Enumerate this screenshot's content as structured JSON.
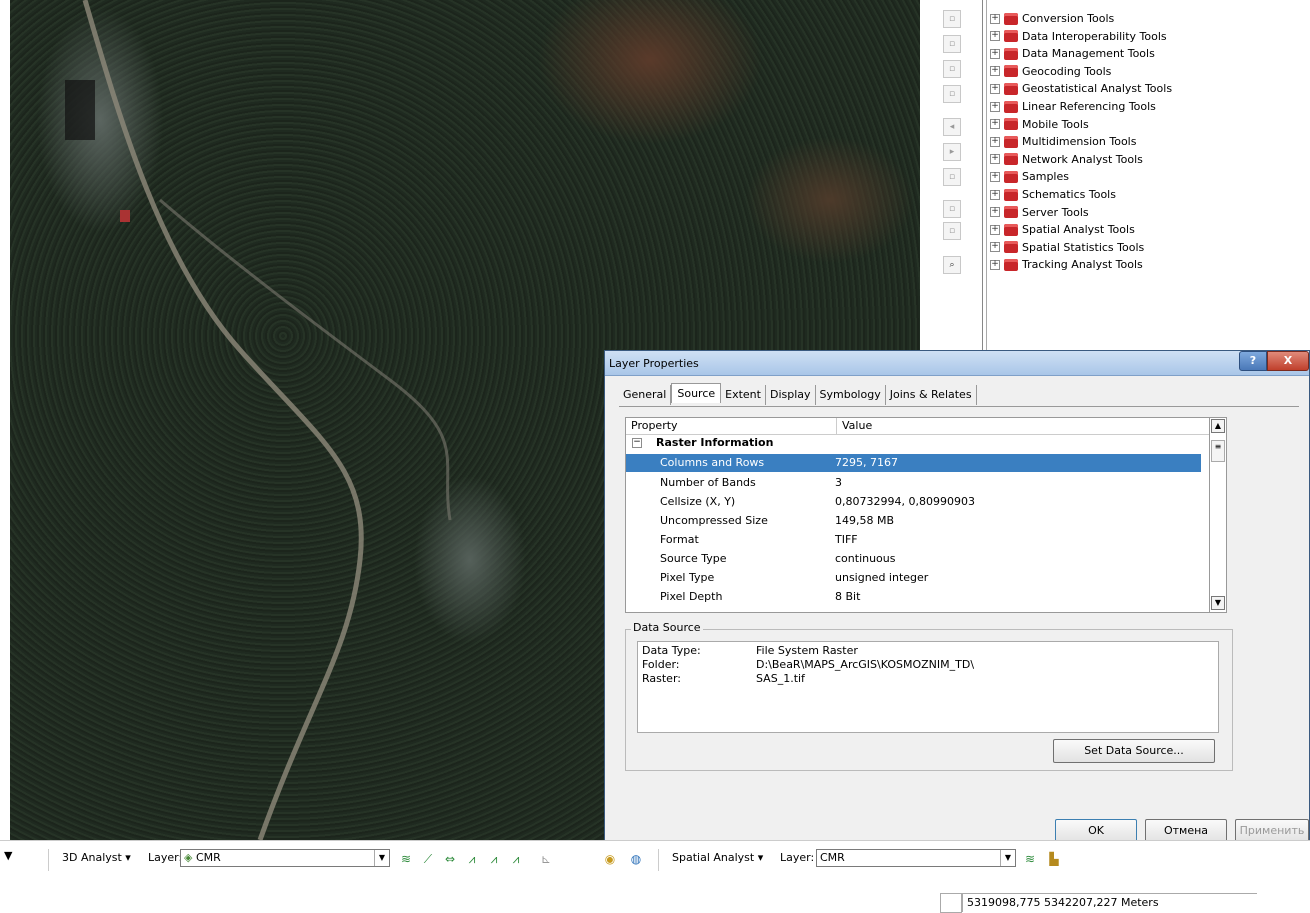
{
  "toolbox": {
    "items": [
      "Conversion Tools",
      "Data Interoperability Tools",
      "Data Management Tools",
      "Geocoding Tools",
      "Geostatistical Analyst Tools",
      "Linear Referencing Tools",
      "Mobile Tools",
      "Multidimension Tools",
      "Network Analyst Tools",
      "Samples",
      "Schematics Tools",
      "Server Tools",
      "Spatial Analyst Tools",
      "Spatial Statistics Tools",
      "Tracking Analyst Tools"
    ]
  },
  "dialog": {
    "title": "Layer Properties",
    "help": "?",
    "close": "X",
    "tabs": [
      "General",
      "Source",
      "Extent",
      "Display",
      "Symbology",
      "Joins & Relates"
    ],
    "active_tab": "Source",
    "grid": {
      "col_property": "Property",
      "col_value": "Value",
      "group": "Raster Information",
      "rows": [
        {
          "k": "Columns and Rows",
          "v": "7295, 7167"
        },
        {
          "k": "Number of Bands",
          "v": "3"
        },
        {
          "k": "Cellsize (X, Y)",
          "v": "0,80732994, 0,80990903"
        },
        {
          "k": "Uncompressed Size",
          "v": "149,58 MB"
        },
        {
          "k": "Format",
          "v": "TIFF"
        },
        {
          "k": "Source Type",
          "v": "continuous"
        },
        {
          "k": "Pixel Type",
          "v": "unsigned integer"
        },
        {
          "k": "Pixel Depth",
          "v": "8 Bit"
        }
      ]
    },
    "data_source": {
      "legend": "Data Source",
      "lines": [
        {
          "k": "Data Type:",
          "v": "File System Raster"
        },
        {
          "k": "Folder:",
          "v": "D:\\BeaR\\MAPS_ArcGIS\\KOSMOZNIM_TD\\"
        },
        {
          "k": "Raster:",
          "v": "SAS_1.tif"
        }
      ],
      "set_button": "Set Data Source..."
    },
    "ok": "OK",
    "cancel": "Отмена",
    "apply": "Применить"
  },
  "toolbar": {
    "analyst3d": "3D Analyst",
    "layer_label1": "Layer:",
    "layer_value1": "CMR",
    "spatial": "Spatial Analyst",
    "layer_label2": "Layer:",
    "layer_value2": "CMR"
  },
  "status": {
    "coords": "5319098,775  5342207,227 Meters"
  }
}
